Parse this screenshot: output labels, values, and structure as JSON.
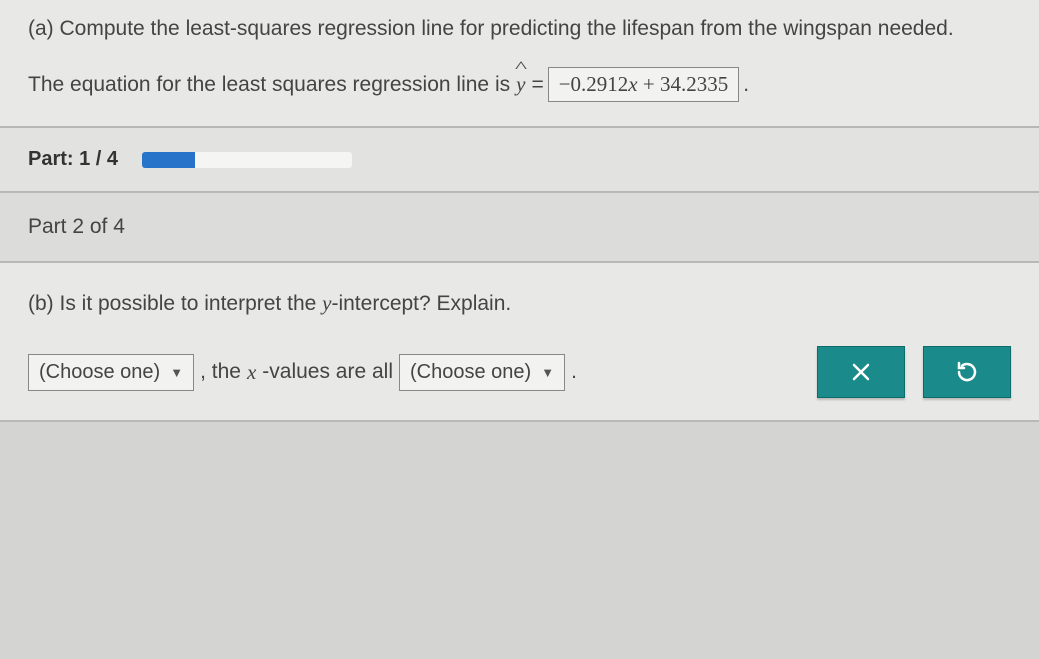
{
  "partA": {
    "question": "(a) Compute the least-squares regression line for predicting the lifespan from the wingspan needed.",
    "equationPrefix": "The equation for the least squares regression line is ",
    "yhat": "y",
    "equals": "=",
    "answer": {
      "coef": "−0.2912",
      "var": "x",
      "plus": " + 34.2335"
    },
    "period": "."
  },
  "progress": {
    "label": "Part: 1 / 4",
    "percent": 25
  },
  "partHeader": "Part 2 of 4",
  "partB": {
    "question_pre": "(b) Is it possible to interpret the ",
    "yvar": "y",
    "question_post": "-intercept? Explain.",
    "dropdown1": "(Choose one)",
    "mid1": ", the ",
    "xvar": "x",
    "mid2": "-values are all ",
    "dropdown2": "(Choose one)",
    "period": "."
  },
  "icons": {
    "close": "close-icon",
    "reset": "reset-icon"
  }
}
